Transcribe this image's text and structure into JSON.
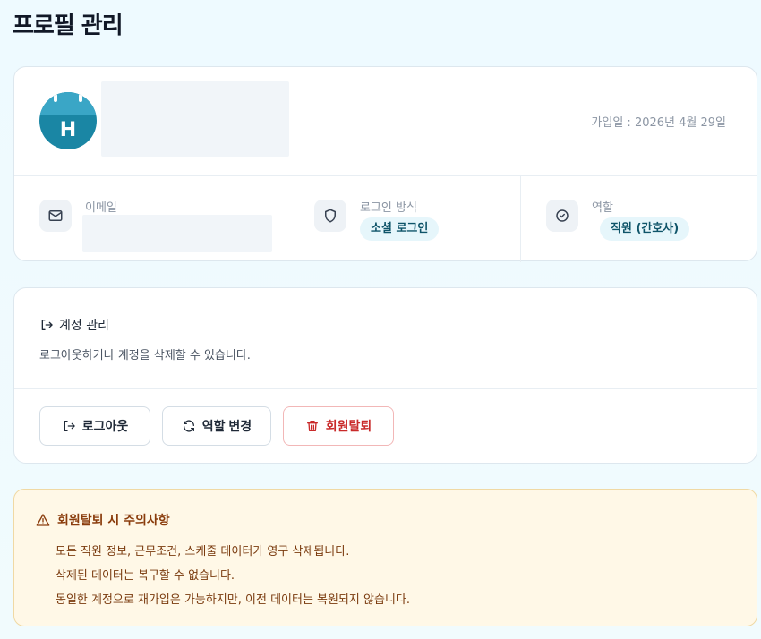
{
  "page": {
    "title": "프로필 관리"
  },
  "profile": {
    "avatar_letter": "H",
    "join_date": "가입일 : 2026년 4월 29일",
    "email_label": "이메일",
    "login_method_label": "로그인 방식",
    "login_method_value": "소셜 로그인",
    "role_label": "역할",
    "role_value": "직원 (간호사)"
  },
  "account": {
    "title": "계정 관리",
    "description": "로그아웃하거나 계정을 삭제할 수 있습니다.",
    "logout_label": "로그아웃",
    "change_role_label": "역할 변경",
    "withdraw_label": "회원탈퇴"
  },
  "warning": {
    "title": "회원탈퇴 시 주의사항",
    "lines": [
      "모든 직원 정보, 근무조건, 스케줄 데이터가 영구 삭제됩니다.",
      "삭제된 데이터는 복구할 수 없습니다.",
      "동일한 계정으로 재가입은 가능하지만, 이전 데이터는 복원되지 않습니다."
    ]
  },
  "colors": {
    "avatar": "#1a86a4",
    "pill_bg": "#e6f6fb",
    "pill_text": "#0e5469",
    "danger": "#c92a2a",
    "warning_bg": "#fff8e7",
    "warning_text": "#7a3a0e"
  },
  "icons": {
    "email": "mail-icon",
    "login": "shield-icon",
    "role": "check-circle-icon",
    "account": "logout-arrow-icon",
    "change_role": "refresh-icon",
    "withdraw": "trash-icon",
    "warning": "warning-triangle-icon"
  }
}
